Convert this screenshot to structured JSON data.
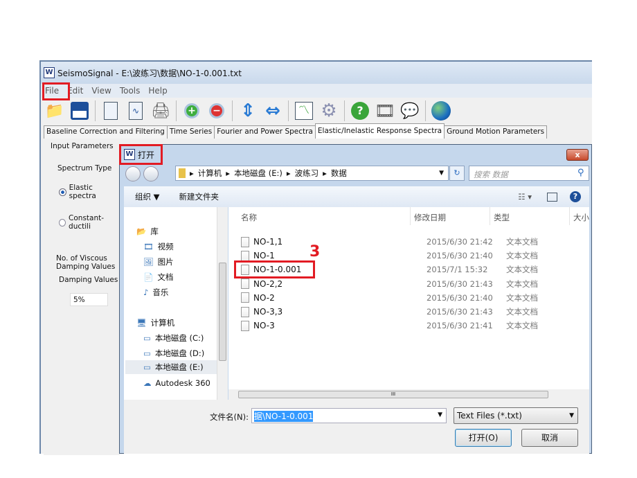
{
  "window": {
    "title": "SeismoSignal - E:\\波练习\\数据\\NO-1-0.001.txt",
    "app_icon": "waveform-icon"
  },
  "menu": [
    "File",
    "Edit",
    "View",
    "Tools",
    "Help"
  ],
  "toolbar": [
    "open-folder-icon",
    "save-icon",
    "new-document-icon",
    "signal-document-icon",
    "print-icon",
    "zoom-in-icon",
    "zoom-out-icon",
    "vertical-arrows-icon",
    "horizontal-arrows-icon",
    "chart-icon",
    "gear-icon",
    "help-icon",
    "film-reel-icon",
    "speech-bubbles-icon",
    "globe-icon"
  ],
  "tabs": [
    "Baseline Correction and Filtering",
    "Time Series",
    "Fourier and Power Spectra",
    "Elastic/Inelastic Response Spectra",
    "Ground Motion Parameters"
  ],
  "active_tab": 3,
  "left_panel": {
    "group": "Input Parameters",
    "spectrum_type": "Spectrum Type",
    "radio_elastic": "Elastic spectra",
    "radio_ductility": "Constant-ductili",
    "viscous": "No. of Viscous Damping Values",
    "damping": "Damping Values",
    "damping_value": "5%"
  },
  "dialog": {
    "title": "打开",
    "close": "x",
    "breadcrumb": [
      "计算机",
      "本地磁盘 (E:)",
      "波练习",
      "数据"
    ],
    "search_placeholder": "搜索 数据",
    "organize": "组织 ▼",
    "new_folder": "新建文件夹",
    "nav": [
      {
        "label": "库",
        "icon": "library-icon"
      },
      {
        "label": "视频",
        "icon": "video-icon"
      },
      {
        "label": "图片",
        "icon": "picture-icon"
      },
      {
        "label": "文档",
        "icon": "document-icon"
      },
      {
        "label": "音乐",
        "icon": "music-icon"
      },
      {
        "label": "计算机",
        "icon": "computer-icon"
      },
      {
        "label": "本地磁盘 (C:)",
        "icon": "drive-icon"
      },
      {
        "label": "本地磁盘 (D:)",
        "icon": "drive-icon"
      },
      {
        "label": "本地磁盘 (E:)",
        "icon": "drive-icon"
      },
      {
        "label": "Autodesk 360",
        "icon": "cloud-icon"
      }
    ],
    "columns": [
      "名称",
      "修改日期",
      "类型",
      "大小"
    ],
    "files": [
      {
        "name": "NO-1,1",
        "date": "2015/6/30 21:42",
        "type": "文本文档"
      },
      {
        "name": "NO-1",
        "date": "2015/6/30 21:40",
        "type": "文本文档"
      },
      {
        "name": "NO-1-0.001",
        "date": "2015/7/1 15:32",
        "type": "文本文档"
      },
      {
        "name": "NO-2,2",
        "date": "2015/6/30 21:43",
        "type": "文本文档"
      },
      {
        "name": "NO-2",
        "date": "2015/6/30 21:40",
        "type": "文本文档"
      },
      {
        "name": "NO-3,3",
        "date": "2015/6/30 21:43",
        "type": "文本文档"
      },
      {
        "name": "NO-3",
        "date": "2015/6/30 21:41",
        "type": "文本文档"
      }
    ],
    "filename_label": "文件名(N):",
    "filename_value": "据\\NO-1-0.001",
    "filter": "Text Files (*.txt)",
    "open_button": "打开(O)",
    "cancel_button": "取消"
  },
  "annotation": {
    "step": "3",
    "color": "#e21b23"
  }
}
